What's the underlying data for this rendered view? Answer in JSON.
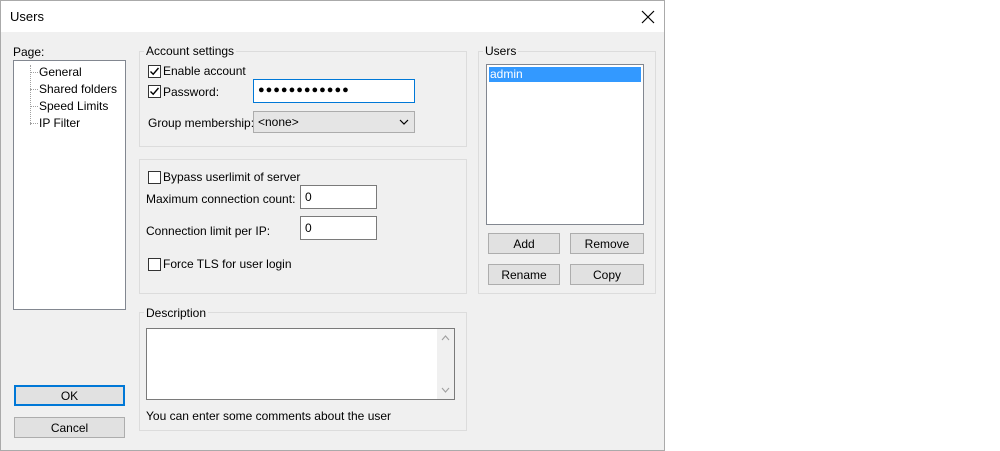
{
  "window": {
    "title": "Users"
  },
  "page_panel": {
    "label": "Page:",
    "items": [
      "General",
      "Shared folders",
      "Speed Limits",
      "IP Filter"
    ],
    "selected": "General"
  },
  "account_settings": {
    "title": "Account settings",
    "enable_account": {
      "label": "Enable account",
      "checked": true
    },
    "password": {
      "label": "Password:",
      "checked": true,
      "value": "●●●●●●●●●●●●"
    },
    "group_membership": {
      "label": "Group membership:",
      "value": "<none>"
    }
  },
  "limits": {
    "bypass": {
      "label": "Bypass userlimit of server",
      "checked": false
    },
    "max_connections": {
      "label": "Maximum connection count:",
      "value": "0"
    },
    "limit_per_ip": {
      "label": "Connection limit per IP:",
      "value": "0"
    },
    "force_tls": {
      "label": "Force TLS for user login",
      "checked": false
    }
  },
  "description": {
    "title": "Description",
    "text": "",
    "hint": "You can enter some comments about the user"
  },
  "users_panel": {
    "title": "Users",
    "items": [
      "admin"
    ],
    "selected": "admin",
    "add_label": "Add",
    "remove_label": "Remove",
    "rename_label": "Rename",
    "copy_label": "Copy"
  },
  "buttons": {
    "ok_label": "OK",
    "cancel_label": "Cancel"
  },
  "colors": {
    "selection": "#3399ff",
    "focus_border": "#0078d7",
    "dialog_bg": "#f0f0f0"
  }
}
